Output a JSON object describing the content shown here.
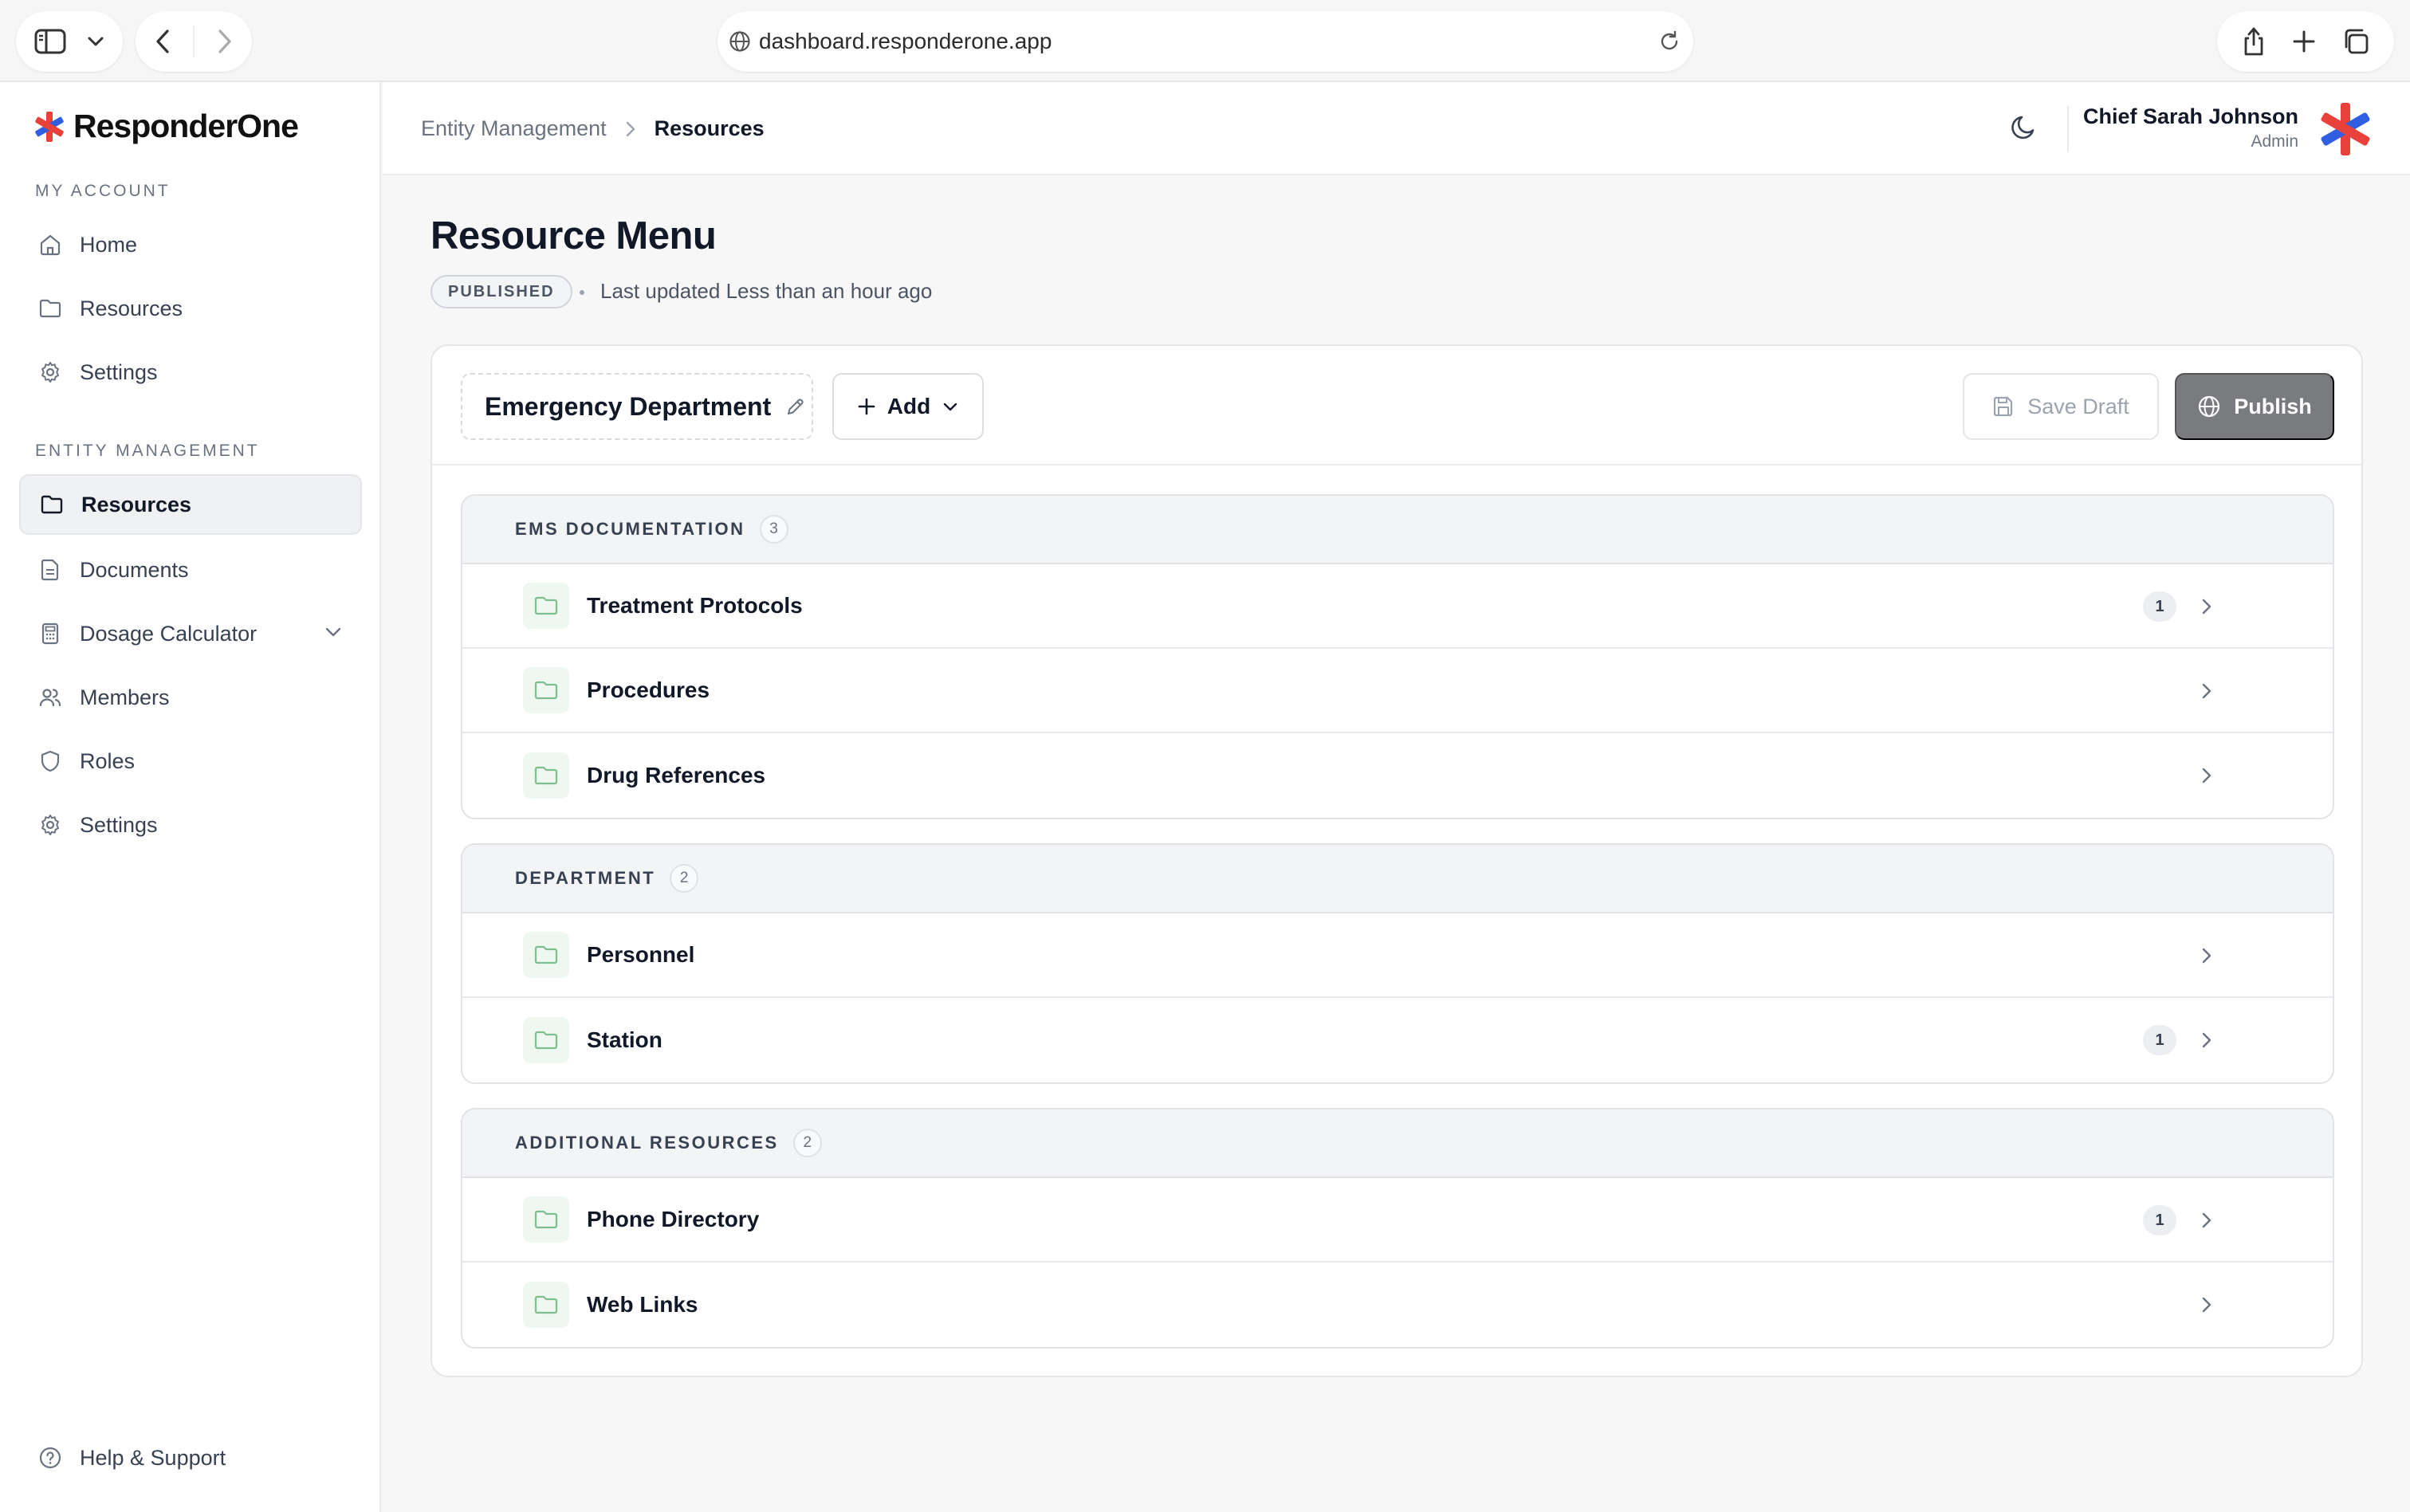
{
  "browser": {
    "url": "dashboard.responderone.app"
  },
  "brand": {
    "name": "ResponderOne",
    "accent_red": "#e8403a",
    "accent_blue": "#2f5fe0"
  },
  "sidebar": {
    "my_account_label": "MY ACCOUNT",
    "my_account_items": [
      {
        "label": "Home",
        "icon": "home-icon"
      },
      {
        "label": "Resources",
        "icon": "folder-icon"
      },
      {
        "label": "Settings",
        "icon": "gear-icon"
      }
    ],
    "entity_label": "ENTITY MANAGEMENT",
    "entity_items": [
      {
        "label": "Resources",
        "icon": "folder-icon",
        "active": true
      },
      {
        "label": "Documents",
        "icon": "document-icon"
      },
      {
        "label": "Dosage Calculator",
        "icon": "calculator-icon",
        "expandable": true
      },
      {
        "label": "Members",
        "icon": "users-icon"
      },
      {
        "label": "Roles",
        "icon": "shield-icon"
      },
      {
        "label": "Settings",
        "icon": "gear-icon"
      }
    ],
    "help_label": "Help & Support"
  },
  "header": {
    "breadcrumb_parent": "Entity Management",
    "breadcrumb_current": "Resources",
    "user_name": "Chief Sarah Johnson",
    "user_role": "Admin"
  },
  "page": {
    "title": "Resource Menu",
    "status": "PUBLISHED",
    "updated": "Last updated Less than an hour ago"
  },
  "editor": {
    "department_name": "Emergency Department",
    "add_label": "Add",
    "save_draft_label": "Save Draft",
    "publish_label": "Publish"
  },
  "groups": [
    {
      "title": "EMS DOCUMENTATION",
      "count": "3",
      "items": [
        {
          "label": "Treatment Protocols",
          "count": "1"
        },
        {
          "label": "Procedures",
          "count": ""
        },
        {
          "label": "Drug References",
          "count": ""
        }
      ]
    },
    {
      "title": "DEPARTMENT",
      "count": "2",
      "items": [
        {
          "label": "Personnel",
          "count": ""
        },
        {
          "label": "Station",
          "count": "1"
        }
      ]
    },
    {
      "title": "ADDITIONAL RESOURCES",
      "count": "2",
      "items": [
        {
          "label": "Phone Directory",
          "count": "1"
        },
        {
          "label": "Web Links",
          "count": ""
        }
      ]
    }
  ]
}
